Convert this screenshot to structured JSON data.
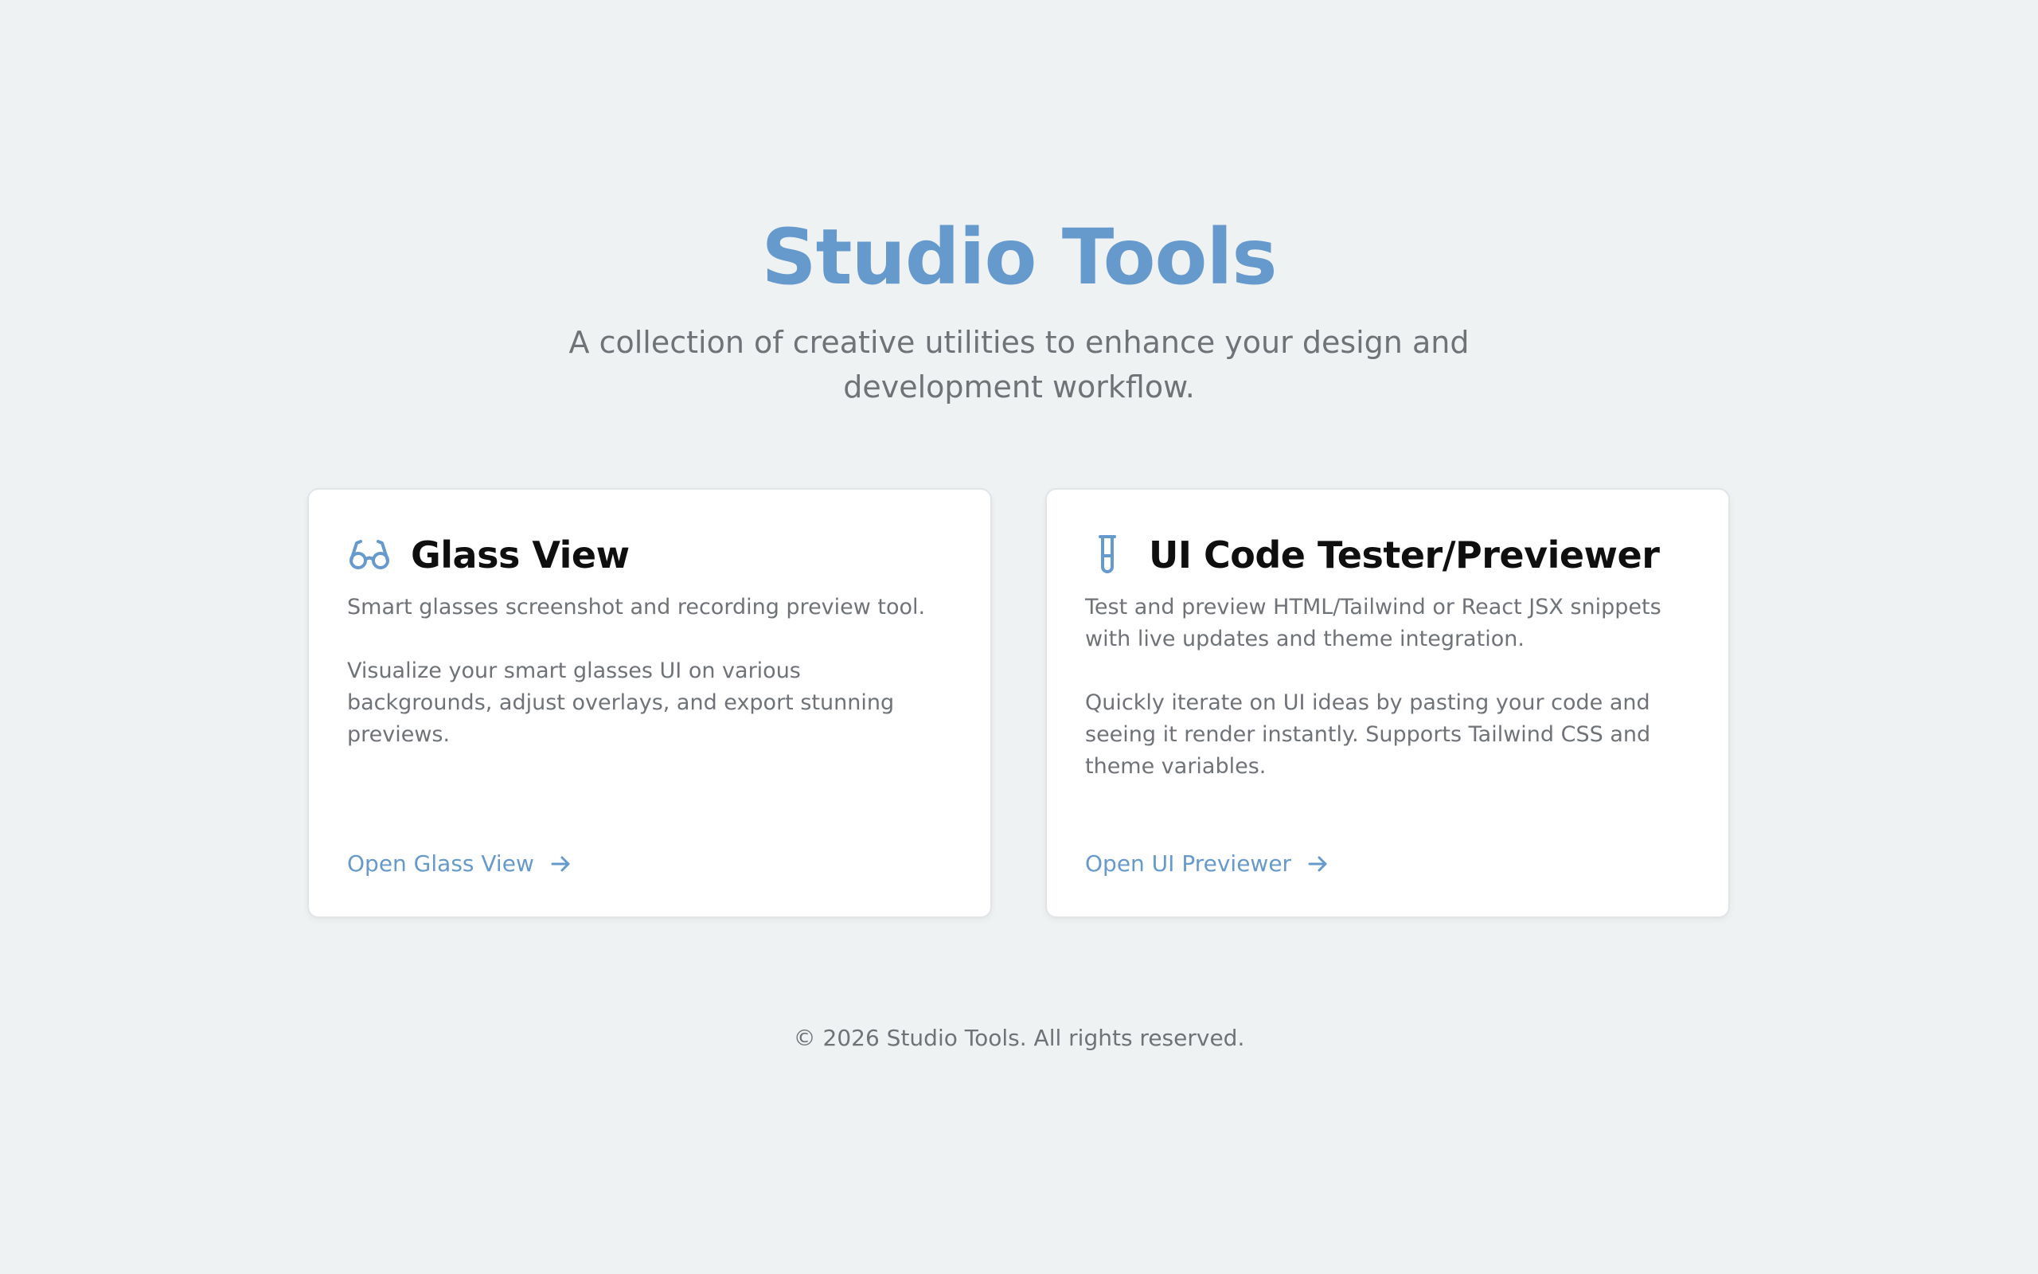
{
  "header": {
    "title": "Studio Tools",
    "subtitle": "A collection of creative utilities to enhance your design and development workflow."
  },
  "cards": [
    {
      "icon": "glasses-icon",
      "title": "Glass View",
      "description": "Smart glasses screenshot and recording preview tool.",
      "detail": "Visualize your smart glasses UI on various backgrounds, adjust overlays, and export stunning previews.",
      "link_label": "Open Glass View"
    },
    {
      "icon": "test-tube-icon",
      "title": "UI Code Tester/Previewer",
      "description": "Test and preview HTML/Tailwind or React JSX snippets with live updates and theme integration.",
      "detail": "Quickly iterate on UI ideas by pasting your code and seeing it render instantly. Supports Tailwind CSS and theme variables.",
      "link_label": "Open UI Previewer"
    }
  ],
  "footer": {
    "text": "© 2026 Studio Tools. All rights reserved."
  },
  "colors": {
    "background": "#eff2f3",
    "accent": "#6699cc",
    "card_background": "#ffffff",
    "muted_text": "#6f7377",
    "heading_text": "#0f0f0f"
  }
}
